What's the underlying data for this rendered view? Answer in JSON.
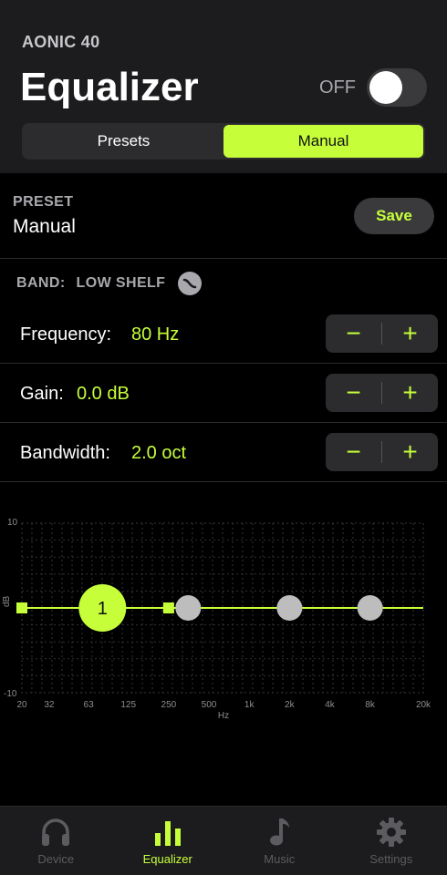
{
  "header": {
    "device_name": "AONIC 40",
    "title": "Equalizer",
    "toggle_label": "OFF",
    "toggle_on": false
  },
  "segments": [
    {
      "label": "Presets",
      "active": false
    },
    {
      "label": "Manual",
      "active": true
    }
  ],
  "preset": {
    "label": "PRESET",
    "value": "Manual",
    "save_label": "Save"
  },
  "band": {
    "label": "BAND:",
    "value": "LOW SHELF",
    "icon": "low-shelf-icon"
  },
  "params": [
    {
      "name": "Frequency:",
      "value": "80 Hz"
    },
    {
      "name": "Gain:",
      "value": "0.0 dB"
    },
    {
      "name": "Bandwidth:",
      "value": "2.0 oct"
    }
  ],
  "stepper": {
    "minus": "−",
    "plus": "+"
  },
  "chart": {
    "y_axis_label": "dB",
    "y_ticks": [
      "10",
      "-10"
    ],
    "x_ticks": [
      "20",
      "32",
      "63",
      "125",
      "250",
      "500",
      "1k",
      "2k",
      "4k",
      "8k",
      "20k"
    ],
    "x_axis_label": "Hz",
    "active_band_label": "1"
  },
  "chart_data": {
    "type": "line",
    "ylim": [
      -10,
      10
    ],
    "xlim": [
      20,
      20000
    ],
    "x_scale": "log",
    "series": [
      {
        "values": [
          0,
          0
        ]
      }
    ],
    "bands": [
      {
        "label": "1",
        "freq": 80,
        "gain": 0,
        "active": true
      },
      {
        "freq": 350,
        "gain": 0,
        "active": false
      },
      {
        "freq": 2000,
        "gain": 0,
        "active": false
      },
      {
        "freq": 8000,
        "gain": 0,
        "active": false
      }
    ],
    "range_markers": [
      20,
      250
    ]
  },
  "tabs": [
    {
      "label": "Device",
      "icon": "headphones-icon",
      "active": false
    },
    {
      "label": "Equalizer",
      "icon": "equalizer-bars-icon",
      "active": true
    },
    {
      "label": "Music",
      "icon": "music-note-icon",
      "active": false
    },
    {
      "label": "Settings",
      "icon": "gear-icon",
      "active": false
    }
  ],
  "colors": {
    "accent": "#c6ff3a",
    "background": "#000000",
    "surface": "#1c1c1e",
    "inactive_band": "#bdbdbd"
  }
}
